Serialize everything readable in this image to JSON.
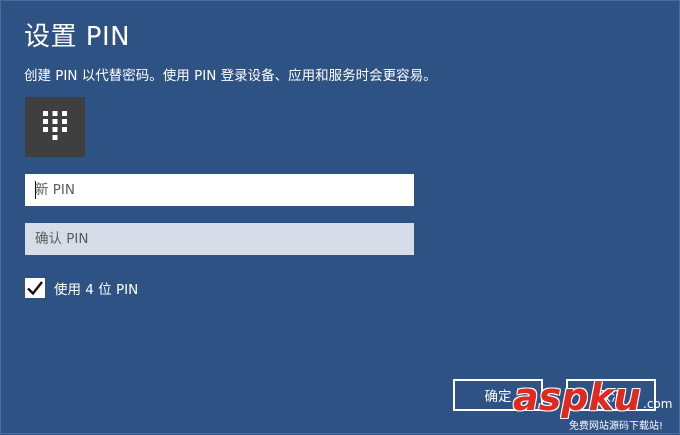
{
  "dialog": {
    "title": "设置 PIN",
    "subtitle": "创建 PIN 以代替密码。使用 PIN 登录设备、应用和服务时会更容易。"
  },
  "icons": {
    "keypad": "keypad-icon",
    "checkmark": "checkmark-icon"
  },
  "fields": {
    "new_pin_placeholder": "新 PIN",
    "confirm_pin_placeholder": "确认 PIN",
    "new_pin_value": "",
    "confirm_pin_value": ""
  },
  "checkbox": {
    "label": "使用 4 位 PIN",
    "checked": true
  },
  "buttons": {
    "ok": "确定",
    "cancel": "取消"
  },
  "watermark": {
    "brand": "aspku",
    "domain": ".com",
    "tagline": "免费网站源码下载站!"
  },
  "colors": {
    "background": "#2d5283",
    "keypad_tile": "#3f3f3f",
    "confirm_field": "#d6dde8",
    "watermark": "#e02a20"
  }
}
